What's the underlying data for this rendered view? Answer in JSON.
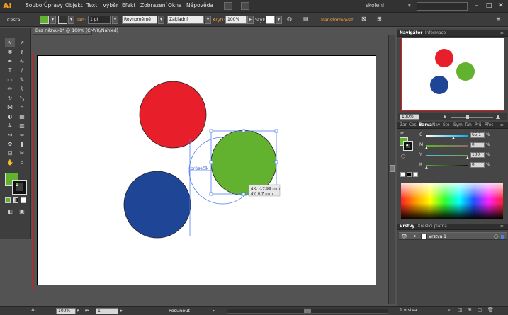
{
  "app": {
    "logo": "Ai",
    "workspace": "skoleni"
  },
  "menu": [
    "Soubor",
    "Úpravy",
    "Objekt",
    "Text",
    "Výběr",
    "Efekt",
    "Zobrazení",
    "Okna",
    "Nápověda"
  ],
  "control_bar": {
    "object_type": "Cesta",
    "stroke_label": "Tah:",
    "stroke_weight": "1 pt",
    "profile": "Rovnoměrně",
    "brush": "Základní",
    "opacity_label": "Krytí:",
    "opacity_value": "100%",
    "style_label": "Styl:",
    "transform_label": "Transformovat"
  },
  "document": {
    "tab_title": "Bez názvu-1* @ 100% (CMYK/Náhled)"
  },
  "smart_guides": {
    "intersect_label": "průsečík",
    "dx": "dX: -17,99 mm",
    "dy": "dY: 6,7 mm"
  },
  "navigator": {
    "tabs": [
      "Navigátor",
      "Informace"
    ],
    "zoom": "100%"
  },
  "color_panel": {
    "tabs": [
      "Zar",
      "Ces",
      "Barva",
      "Nav",
      "Sto",
      "Sym",
      "Tah",
      "Prů",
      "Přec"
    ],
    "channels": [
      {
        "label": "C",
        "value": "65,1",
        "unit": "%"
      },
      {
        "label": "M",
        "value": "0",
        "unit": "%"
      },
      {
        "label": "Y",
        "value": "100",
        "unit": "%"
      },
      {
        "label": "K",
        "value": "0",
        "unit": "%"
      }
    ]
  },
  "layers": {
    "tabs": [
      "Vrstvy",
      "Kreslicí plátna"
    ],
    "layer_name": "Vrstva 1",
    "status": "1 vrstva"
  },
  "status_bar": {
    "zoom": "100%",
    "artboard": "1",
    "tool_hint": "Posunout"
  },
  "colors": {
    "red_circle": "#e81e2a",
    "green_circle": "#62b22f",
    "blue_circle": "#1f4596",
    "fill_swatch": "#62b22f",
    "selection": "#4f7df0"
  }
}
